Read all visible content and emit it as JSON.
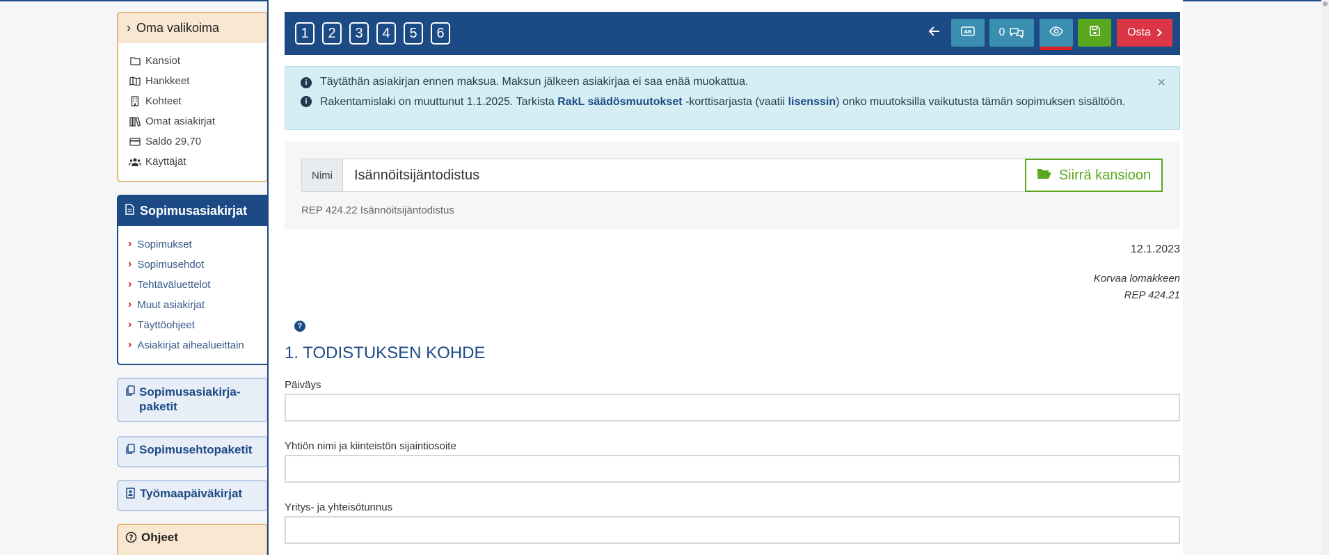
{
  "sidebar": {
    "own": {
      "title": "Oma valikoima",
      "items": [
        {
          "label": "Kansiot",
          "icon": "folder-icon"
        },
        {
          "label": "Hankkeet",
          "icon": "map-icon"
        },
        {
          "label": "Kohteet",
          "icon": "building-icon"
        },
        {
          "label": "Omat asiakirjat",
          "icon": "books-icon"
        },
        {
          "label": "Saldo 29,70",
          "icon": "credit-card-icon"
        },
        {
          "label": "Käyttäjät",
          "icon": "users-icon"
        }
      ]
    },
    "contracts": {
      "title": "Sopimusasiakirjat",
      "items": [
        {
          "label": "Sopimukset"
        },
        {
          "label": "Sopimusehdot"
        },
        {
          "label": "Tehtäväluettelot"
        },
        {
          "label": "Muut asiakirjat"
        },
        {
          "label": "Täyttöohjeet"
        },
        {
          "label": "Asiakirjat aihealueittain"
        }
      ]
    },
    "packages": [
      {
        "label": "Sopimusasiakirja-paketit"
      },
      {
        "label": "Sopimusehtopaketit"
      },
      {
        "label": "Työmaapäiväkirjat"
      }
    ],
    "help": {
      "label": "Ohjeet"
    }
  },
  "toolbar": {
    "steps": [
      "1",
      "2",
      "3",
      "4",
      "5",
      "6"
    ],
    "comments_count": "0",
    "buy_label": "Osta"
  },
  "alert": {
    "line1": "Täytäthän asiakirjan ennen maksua. Maksun jälkeen asiakirjaa ei saa enää muokattua.",
    "line2_pre": "Rakentamislaki on muuttunut 1.1.2025. Tarkista ",
    "line2_link1": "RakL säädösmuutokset",
    "line2_mid": " -korttisarjasta (vaatii ",
    "line2_link2": "lisenssin",
    "line2_post": ") onko muutoksilla vaikutusta tämän sopimuksen sisältöön."
  },
  "document": {
    "name_label": "Nimi",
    "name_value": "Isännöitsijäntodistus",
    "move_label": "Siirrä kansioon",
    "code": "REP 424.22 Isännöitsijäntodistus",
    "date": "12.1.2023",
    "replaces_line1": "Korvaa lomakkeen",
    "replaces_line2": "REP 424.21"
  },
  "form": {
    "section_title": "1. TODISTUKSEN KOHDE",
    "fields": [
      {
        "label": "Päiväys",
        "value": ""
      },
      {
        "label": "Yhtiön nimi ja kiinteistön sijaintiosoite",
        "value": ""
      },
      {
        "label": "Yritys- ja yhteisötunnus",
        "value": ""
      }
    ]
  },
  "colors": {
    "brand_blue": "#1c4a85",
    "accent_teal": "#3a8fb0",
    "save_green": "#58a71e",
    "buy_red": "#dc3545"
  }
}
